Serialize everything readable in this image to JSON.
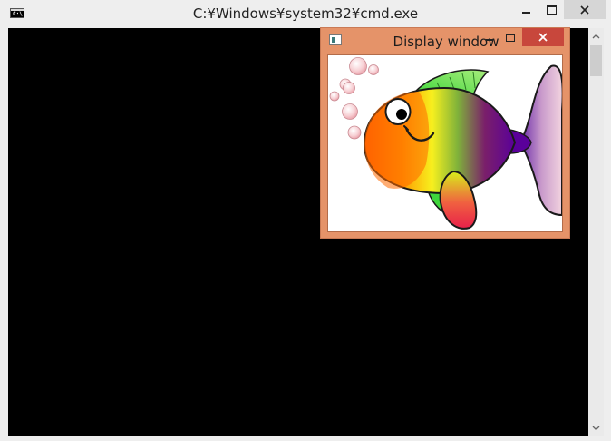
{
  "console_window": {
    "title": "C:¥Windows¥system32¥cmd.exe",
    "icon": "cmd-console-icon",
    "icon_text": "C:\\",
    "background": "#000000",
    "buttons": [
      "minimize-icon",
      "maximize-icon",
      "close-icon"
    ]
  },
  "display_window": {
    "title": "Display window",
    "icon": "window-app-icon",
    "accent": "#e59369",
    "close_color": "#c8473c",
    "buttons": [
      "minimize-icon",
      "maximize-icon",
      "close-icon"
    ],
    "image": "cartoon-fish-with-bubbles"
  }
}
